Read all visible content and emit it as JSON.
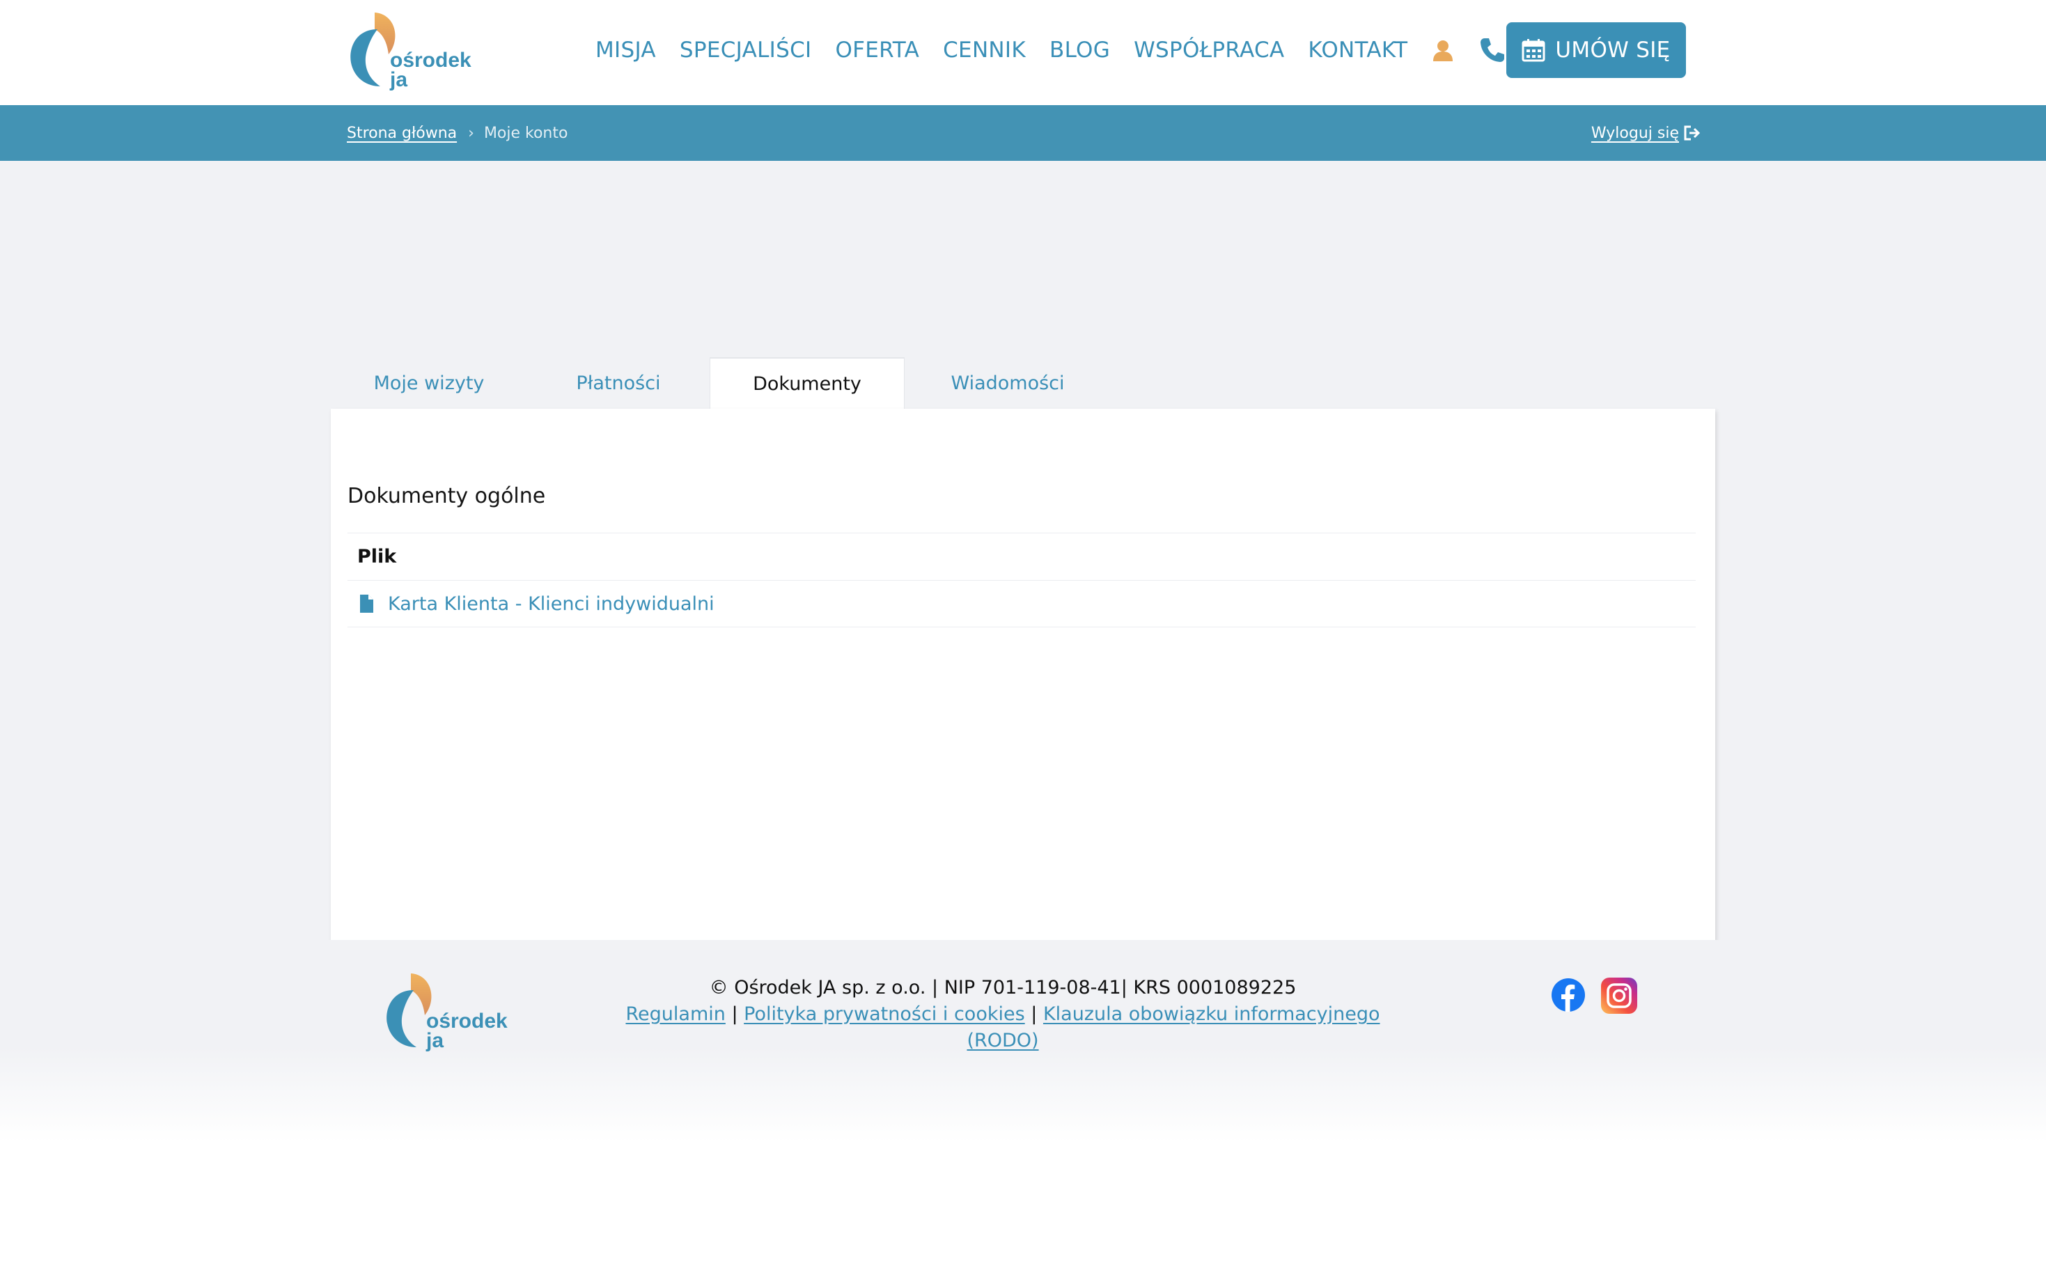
{
  "header": {
    "logo_text_line1": "ośrodek",
    "logo_text_line2": "ja",
    "nav": [
      "MISJA",
      "SPECJALIŚCI",
      "OFERTA",
      "CENNIK",
      "BLOG",
      "WSPÓŁPRACA",
      "KONTAKT"
    ],
    "cta_label": "UMÓW SIĘ"
  },
  "breadcrumb": {
    "home": "Strona główna",
    "separator": "›",
    "current": "Moje konto",
    "logout": "Wyloguj się"
  },
  "tabs": [
    {
      "label": "Moje wizyty",
      "active": false
    },
    {
      "label": "Płatności",
      "active": false
    },
    {
      "label": "Dokumenty",
      "active": true
    },
    {
      "label": "Wiadomości",
      "active": false
    }
  ],
  "documents": {
    "section_title": "Dokumenty ogólne",
    "column_header": "Plik",
    "files": [
      "Karta Klienta - Klienci indywidualni"
    ]
  },
  "footer": {
    "copyright": "© Ośrodek JA sp. z o.o. | NIP 701-119-08-41| KRS 0001089225",
    "links": [
      "Regulamin",
      "Polityka prywatności i cookies",
      "Klauzula obowiązku informacyjnego (RODO)"
    ],
    "link_separator": " | "
  },
  "colors": {
    "brand_blue": "#3b90b6",
    "band_blue": "#4393b4",
    "logo_orange": "#e9a95b",
    "background": "#f1f2f5"
  },
  "icons": [
    "user-icon",
    "phone-icon",
    "calendar-icon",
    "logout-icon",
    "file-icon",
    "facebook-icon",
    "instagram-icon"
  ]
}
